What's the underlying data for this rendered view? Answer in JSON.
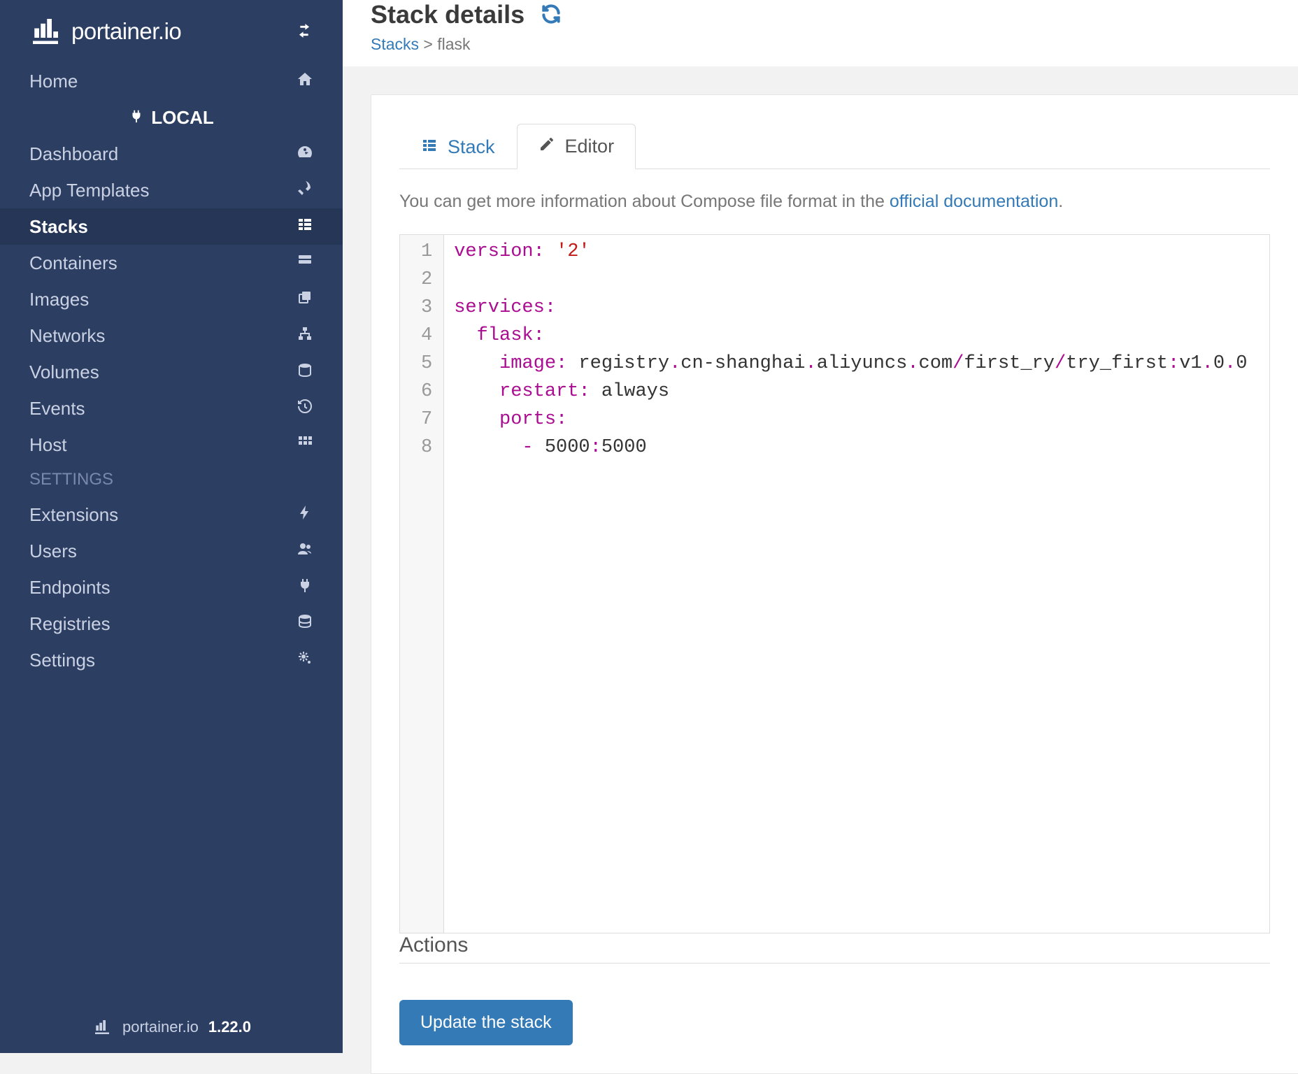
{
  "brand": "portainer.io",
  "version": "1.22.0",
  "local_label": "LOCAL",
  "sidebar": {
    "home": "Home",
    "items": [
      {
        "label": "Dashboard"
      },
      {
        "label": "App Templates"
      },
      {
        "label": "Stacks"
      },
      {
        "label": "Containers"
      },
      {
        "label": "Images"
      },
      {
        "label": "Networks"
      },
      {
        "label": "Volumes"
      },
      {
        "label": "Events"
      },
      {
        "label": "Host"
      }
    ],
    "settings_label": "SETTINGS",
    "settings_items": [
      {
        "label": "Extensions"
      },
      {
        "label": "Users"
      },
      {
        "label": "Endpoints"
      },
      {
        "label": "Registries"
      },
      {
        "label": "Settings"
      }
    ]
  },
  "page": {
    "title": "Stack details",
    "breadcrumb_root": "Stacks",
    "breadcrumb_sep": " > ",
    "breadcrumb_current": "flask"
  },
  "tabs": {
    "stack": "Stack",
    "editor": "Editor"
  },
  "hint_prefix": "You can get more information about Compose file format in the ",
  "hint_link": "official documentation",
  "hint_suffix": ".",
  "editor": {
    "line_count": 8,
    "compose": {
      "version": "2",
      "services": {
        "flask": {
          "image": "registry.cn-shanghai.aliyuncs.com/first_ry/try_first:v1.0.0",
          "restart": "always",
          "ports": [
            "5000:5000"
          ]
        }
      }
    }
  },
  "actions_header": "Actions",
  "update_btn": "Update the stack"
}
